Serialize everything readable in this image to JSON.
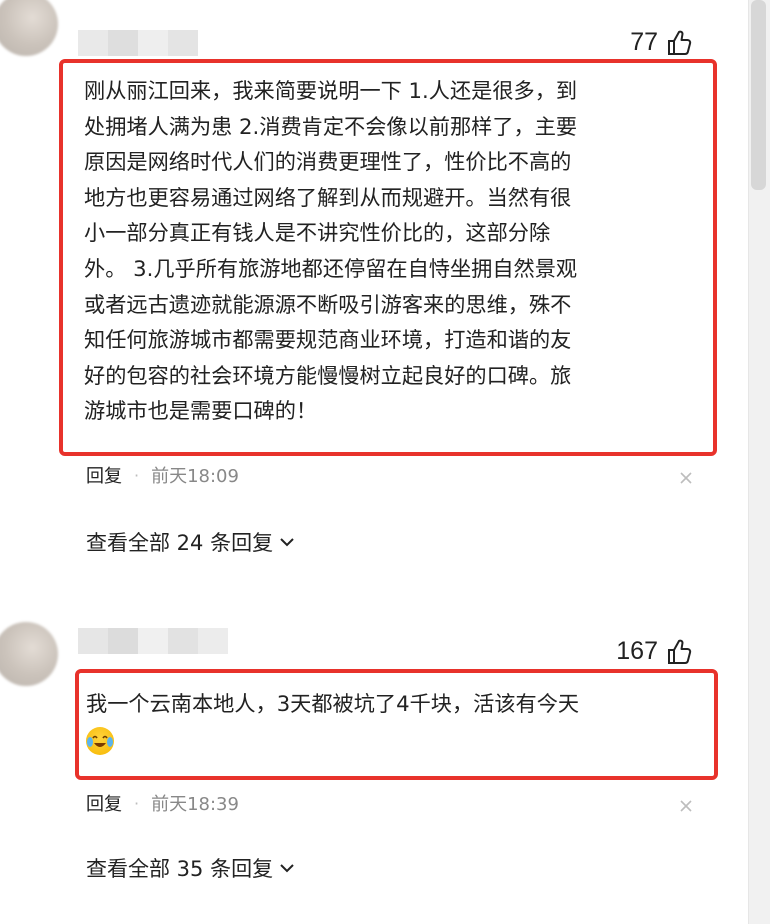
{
  "comments": [
    {
      "likes": "77",
      "text_lines": [
        "刚从丽江回来，我来简要说明一下 1.人还是很多，到",
        "处拥堵人满为患 2.消费肯定不会像以前那样了，主要",
        "原因是网络时代人们的消费更理性了，性价比不高的",
        "地方也更容易通过网络了解到从而规避开。当然有很",
        "小一部分真正有钱人是不讲究性价比的，这部分除",
        "外。 3.几乎所有旅游地都还停留在自恃坐拥自然景观",
        "或者远古遗迹就能源源不断吸引游客来的思维，殊不",
        "知任何旅游城市都需要规范商业环境，打造和谐的友",
        "好的包容的社会环境方能慢慢树立起良好的口碑。旅",
        "游城市也是需要口碑的！"
      ],
      "reply_label": "回复",
      "time": "前天18:09",
      "view_replies": "查看全部 24 条回复"
    },
    {
      "likes": "167",
      "text_lines": [
        "我一个云南本地人，3天都被坑了4千块，活该有今天"
      ],
      "emoji": "crying-laughing-emoji",
      "reply_label": "回复",
      "time": "前天18:39",
      "view_replies": "查看全部 35 条回复"
    }
  ],
  "colors": {
    "highlight": "#e8322b",
    "meta_gray": "#888888"
  }
}
